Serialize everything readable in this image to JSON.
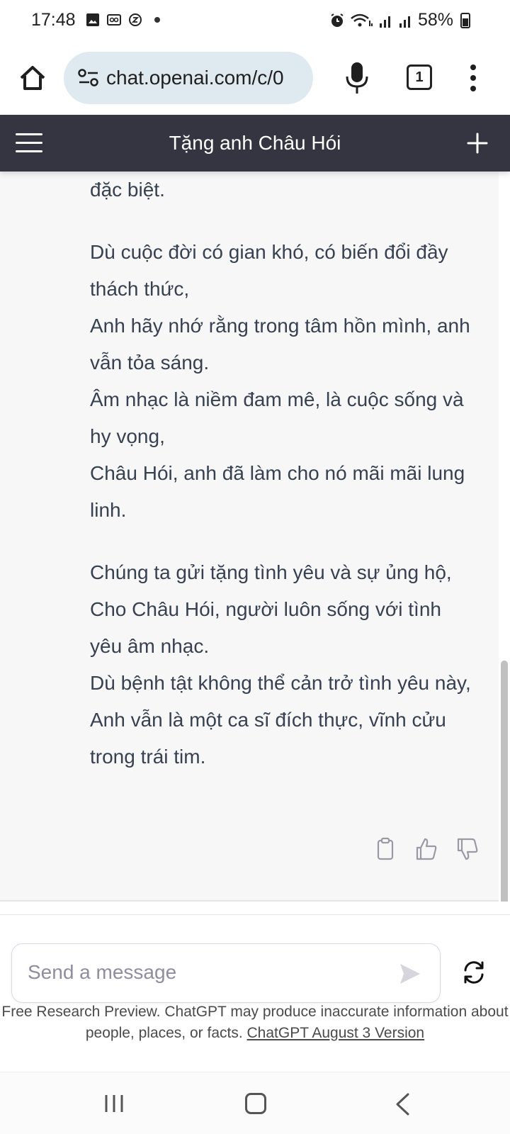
{
  "status_bar": {
    "time": "17:48",
    "battery": "58%",
    "icons": [
      "gallery-icon",
      "voicemail-icon",
      "sync-icon",
      "alarm-icon",
      "wifi-icon",
      "signal-icon",
      "battery-icon"
    ]
  },
  "browser": {
    "url": "chat.openai.com/c/0",
    "tab_count": "1"
  },
  "chat": {
    "title": "Tặng anh Châu Hói",
    "partial_top_line": "đặc biệt.",
    "stanzas": [
      {
        "lines": [
          "Dù cuộc đời có gian khó, có biến đổi đầy thách thức,",
          "Anh hãy nhớ rằng trong tâm hồn mình, anh vẫn tỏa sáng.",
          "Âm nhạc là niềm đam mê, là cuộc sống và hy vọng,",
          "Châu Hói, anh đã làm cho nó mãi mãi lung linh."
        ]
      },
      {
        "lines": [
          "Chúng ta gửi tặng tình yêu và sự ủng hộ,",
          "Cho Châu Hói, người luôn sống với tình yêu âm nhạc.",
          "Dù bệnh tật không thể cản trở tình yêu này,",
          "Anh vẫn là một ca sĩ đích thực, vĩnh cửu trong trái tim."
        ]
      }
    ]
  },
  "composer": {
    "placeholder": "Send a message"
  },
  "disclaimer": {
    "text": "Free Research Preview. ChatGPT may produce inaccurate information about people, places, or facts.",
    "link": "ChatGPT August 3 Version"
  }
}
